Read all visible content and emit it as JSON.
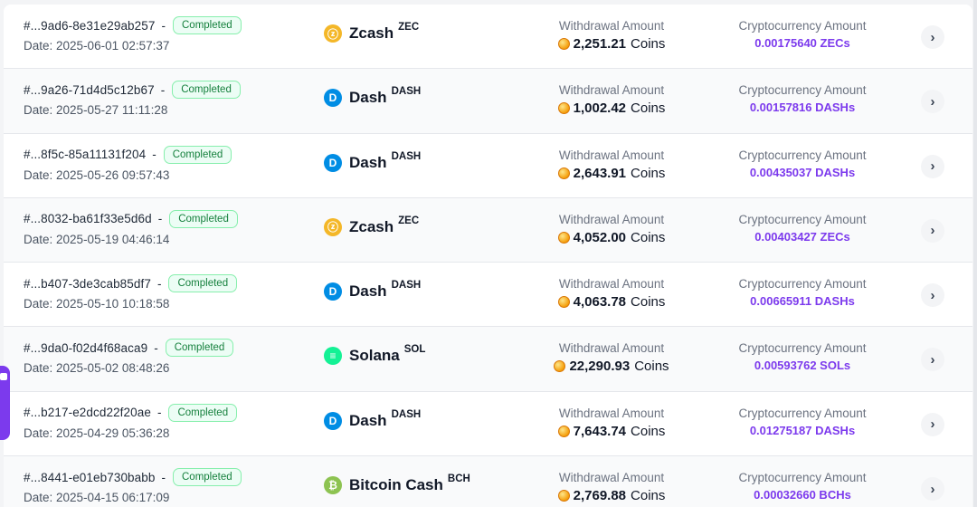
{
  "labels": {
    "withdrawal_amount": "Withdrawal Amount",
    "crypto_amount": "Cryptocurrency Amount",
    "date_prefix": "Date: ",
    "coins_unit": "Coins",
    "id_separator": "-"
  },
  "colors": {
    "accent": "#7c3aed",
    "completed_text": "#15803d",
    "completed_bg": "#ecfdf5"
  },
  "rows": [
    {
      "id": "#...9ad6-8e31e29ab257",
      "status": "Completed",
      "date": "2025-06-01 02:57:37",
      "coin": "Zcash",
      "symbol": "ZEC",
      "icon": "zcash-icon",
      "icon_glyph": "ⓩ",
      "icon_color": "#f4b728",
      "withdrawal": "2,251.21",
      "crypto": "0.00175640 ZECs"
    },
    {
      "id": "#...9a26-71d4d5c12b67",
      "status": "Completed",
      "date": "2025-05-27 11:11:28",
      "coin": "Dash",
      "symbol": "DASH",
      "icon": "dash-icon",
      "icon_glyph": "D",
      "icon_color": "#008de4",
      "withdrawal": "1,002.42",
      "crypto": "0.00157816 DASHs"
    },
    {
      "id": "#...8f5c-85a11131f204",
      "status": "Completed",
      "date": "2025-05-26 09:57:43",
      "coin": "Dash",
      "symbol": "DASH",
      "icon": "dash-icon",
      "icon_glyph": "D",
      "icon_color": "#008de4",
      "withdrawal": "2,643.91",
      "crypto": "0.00435037 DASHs"
    },
    {
      "id": "#...8032-ba61f33e5d6d",
      "status": "Completed",
      "date": "2025-05-19 04:46:14",
      "coin": "Zcash",
      "symbol": "ZEC",
      "icon": "zcash-icon",
      "icon_glyph": "ⓩ",
      "icon_color": "#f4b728",
      "withdrawal": "4,052.00",
      "crypto": "0.00403427 ZECs"
    },
    {
      "id": "#...b407-3de3cab85df7",
      "status": "Completed",
      "date": "2025-05-10 10:18:58",
      "coin": "Dash",
      "symbol": "DASH",
      "icon": "dash-icon",
      "icon_glyph": "D",
      "icon_color": "#008de4",
      "withdrawal": "4,063.78",
      "crypto": "0.00665911 DASHs"
    },
    {
      "id": "#...9da0-f02d4f68aca9",
      "status": "Completed",
      "date": "2025-05-02 08:48:26",
      "coin": "Solana",
      "symbol": "SOL",
      "icon": "solana-icon",
      "icon_glyph": "≡",
      "icon_color": "#14f195",
      "withdrawal": "22,290.93",
      "crypto": "0.00593762 SOLs"
    },
    {
      "id": "#...b217-e2dcd22f20ae",
      "status": "Completed",
      "date": "2025-04-29 05:36:28",
      "coin": "Dash",
      "symbol": "DASH",
      "icon": "dash-icon",
      "icon_glyph": "D",
      "icon_color": "#008de4",
      "withdrawal": "7,643.74",
      "crypto": "0.01275187 DASHs"
    },
    {
      "id": "#...8441-e01eb730babb",
      "status": "Completed",
      "date": "2025-04-15 06:17:09",
      "coin": "Bitcoin Cash",
      "symbol": "BCH",
      "icon": "bitcoin-cash-icon",
      "icon_glyph": "₿",
      "icon_color": "#8dc351",
      "withdrawal": "2,769.88",
      "crypto": "0.00032660 BCHs"
    }
  ]
}
